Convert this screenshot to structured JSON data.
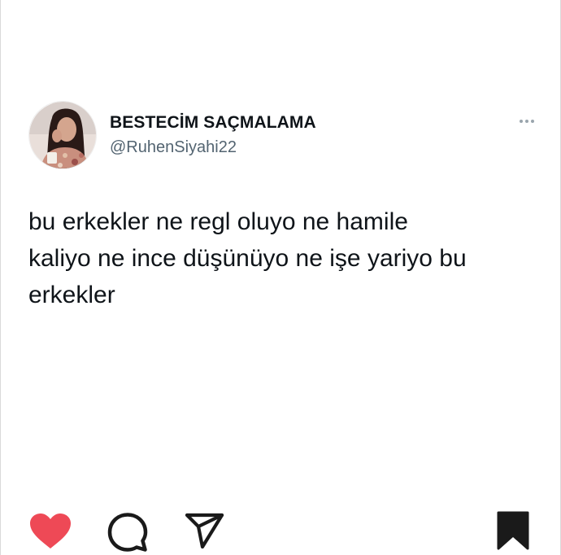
{
  "tweet": {
    "display_name": "BESTECİM SAÇMALAMA",
    "handle": "@RuhenSiyahi22",
    "text": "bu erkekler ne regl oluyo ne hamile\nkaliyo ne ince düşünüyo ne işe yariyo bu\nerkekler",
    "more_icon": "more-horizontal-icon"
  },
  "actions": {
    "like_icon": "heart-filled-icon",
    "comment_icon": "comment-bubble-icon",
    "share_icon": "paper-plane-icon",
    "save_icon": "bookmark-filled-icon"
  },
  "colors": {
    "like": "#ee4956",
    "text": "#0f1419",
    "secondary_text": "#536471",
    "icon_dark": "#1a1a1a"
  }
}
